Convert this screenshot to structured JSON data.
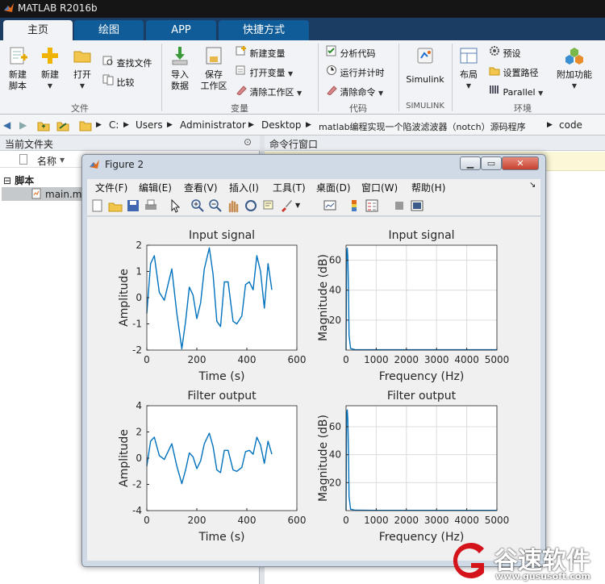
{
  "window": {
    "title": "MATLAB R2016b"
  },
  "tabs": [
    {
      "label": "主页",
      "active": true
    },
    {
      "label": "绘图",
      "active": false
    },
    {
      "label": "APP",
      "active": false
    },
    {
      "label": "快捷方式",
      "active": false
    }
  ],
  "ribbon": {
    "file": {
      "new_script": [
        "新建",
        "脚本"
      ],
      "new": "新建",
      "open": "打开",
      "find_files": "查找文件",
      "compare": "比较",
      "group": "文件"
    },
    "variable": {
      "import": [
        "导入",
        "数据"
      ],
      "save_ws": [
        "保存",
        "工作区"
      ],
      "new_var": "新建变量",
      "open_var": "打开变量",
      "clear_ws": "清除工作区",
      "group": "变量"
    },
    "code": {
      "analyze": "分析代码",
      "run_time": "运行并计时",
      "clear_cmd": "清除命令",
      "group": "代码"
    },
    "simulink": {
      "label": "Simulink",
      "group": "SIMULINK"
    },
    "env": {
      "layout": "布局",
      "prefs": "预设",
      "set_path": "设置路径",
      "parallel": "Parallel",
      "addons": "附加功能",
      "group": "环境"
    }
  },
  "path": [
    "C:",
    "Users",
    "Administrator",
    "Desktop",
    "matlab编程实现一个陷波滤波器（notch）源码程序",
    "code"
  ],
  "left_panel": {
    "title": "当前文件夹",
    "col_name": "名称",
    "group": "脚本",
    "file": "main.m"
  },
  "cmd_panel": {
    "title": "命令行窗口"
  },
  "figure": {
    "title": "Figure 2",
    "menu": [
      "文件(F)",
      "编辑(E)",
      "查看(V)",
      "插入(I)",
      "工具(T)",
      "桌面(D)",
      "窗口(W)",
      "帮助(H)"
    ]
  },
  "chart_data": [
    {
      "type": "line",
      "title": "Input signal",
      "xlabel": "Time (s)",
      "ylabel": "Amplitude",
      "xlim": [
        0,
        600
      ],
      "ylim": [
        -2,
        2
      ],
      "xticks": [
        0,
        200,
        400,
        600
      ],
      "yticks": [
        -2,
        -1,
        0,
        1,
        2
      ],
      "grid": false,
      "color": "#0072bd",
      "x": [
        0,
        15,
        30,
        50,
        70,
        85,
        100,
        120,
        140,
        155,
        170,
        185,
        200,
        215,
        230,
        250,
        265,
        280,
        295,
        310,
        325,
        345,
        360,
        380,
        395,
        410,
        425,
        440,
        455,
        470,
        485,
        500
      ],
      "y": [
        -0.6,
        1.3,
        1.6,
        0.2,
        -0.1,
        0.5,
        1.1,
        -0.6,
        -1.95,
        -0.9,
        0.4,
        0.1,
        -0.8,
        -0.2,
        1.1,
        1.9,
        0.9,
        -0.9,
        -1.1,
        0.6,
        0.6,
        -0.9,
        -1.0,
        -0.7,
        0.5,
        0.6,
        0.3,
        1.6,
        1.0,
        -0.4,
        1.3,
        0.3
      ]
    },
    {
      "type": "line",
      "title": "Input signal",
      "xlabel": "Frequency (Hz)",
      "ylabel": "Magnitude (dB)",
      "xlim": [
        0,
        5000
      ],
      "ylim": [
        0,
        70
      ],
      "xticks": [
        0,
        1000,
        2000,
        3000,
        4000,
        5000
      ],
      "yticks": [
        20,
        40,
        60
      ],
      "grid": true,
      "color": "#0072bd",
      "x": [
        0,
        20,
        40,
        60,
        80,
        100,
        150,
        300,
        1000,
        5000
      ],
      "y": [
        0,
        65,
        68,
        62,
        40,
        10,
        1,
        0.3,
        0.2,
        0.2
      ]
    },
    {
      "type": "line",
      "title": "Filter output",
      "xlabel": "Time (s)",
      "ylabel": "Amplitude",
      "xlim": [
        0,
        600
      ],
      "ylim": [
        -4,
        4
      ],
      "xticks": [
        0,
        200,
        400,
        600
      ],
      "yticks": [
        -4,
        -2,
        0,
        2,
        4
      ],
      "grid": false,
      "color": "#0072bd",
      "x": [
        0,
        15,
        30,
        50,
        70,
        85,
        100,
        120,
        140,
        155,
        170,
        185,
        200,
        215,
        230,
        250,
        265,
        280,
        295,
        310,
        325,
        345,
        360,
        380,
        395,
        410,
        425,
        440,
        455,
        470,
        485,
        500
      ],
      "y": [
        -0.6,
        1.3,
        1.6,
        0.2,
        -0.1,
        0.5,
        1.1,
        -0.6,
        -1.95,
        -0.9,
        0.4,
        0.1,
        -0.8,
        -0.2,
        1.1,
        1.9,
        0.9,
        -0.9,
        -1.1,
        0.6,
        0.6,
        -0.9,
        -1.0,
        -0.7,
        0.5,
        0.6,
        0.3,
        1.6,
        1.0,
        -0.4,
        1.3,
        0.3
      ]
    },
    {
      "type": "line",
      "title": "Filter output",
      "xlabel": "Frequency (Hz)",
      "ylabel": "Magnitude (dB)",
      "xlim": [
        0,
        5000
      ],
      "ylim": [
        0,
        75
      ],
      "xticks": [
        0,
        1000,
        2000,
        3000,
        4000,
        5000
      ],
      "yticks": [
        20,
        40,
        60
      ],
      "grid": true,
      "color": "#0072bd",
      "x": [
        0,
        20,
        40,
        60,
        80,
        100,
        150,
        300,
        1000,
        5000
      ],
      "y": [
        0,
        70,
        72,
        65,
        42,
        10,
        1,
        0.3,
        0.2,
        0.2
      ]
    }
  ],
  "watermark": {
    "brand": "谷速软件",
    "url": "www.gususoft.com",
    "color": "#d4141a"
  }
}
